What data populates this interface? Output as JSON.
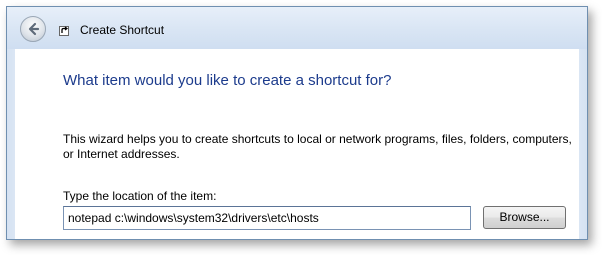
{
  "window": {
    "title": "Create Shortcut",
    "back_icon": "back-arrow-icon",
    "title_icon": "shortcut-icon"
  },
  "wizard": {
    "heading": "What item would you like to create a shortcut for?",
    "description": "This wizard helps you to create shortcuts to local or network programs, files, folders, computers, or Internet addresses.",
    "location_label": "Type the location of the item:",
    "location_value": "notepad c:\\windows\\system32\\drivers\\etc\\hosts",
    "browse_label": "Browse..."
  },
  "colors": {
    "heading": "#1c3b8c",
    "titlebar": "#dbe6f4"
  }
}
